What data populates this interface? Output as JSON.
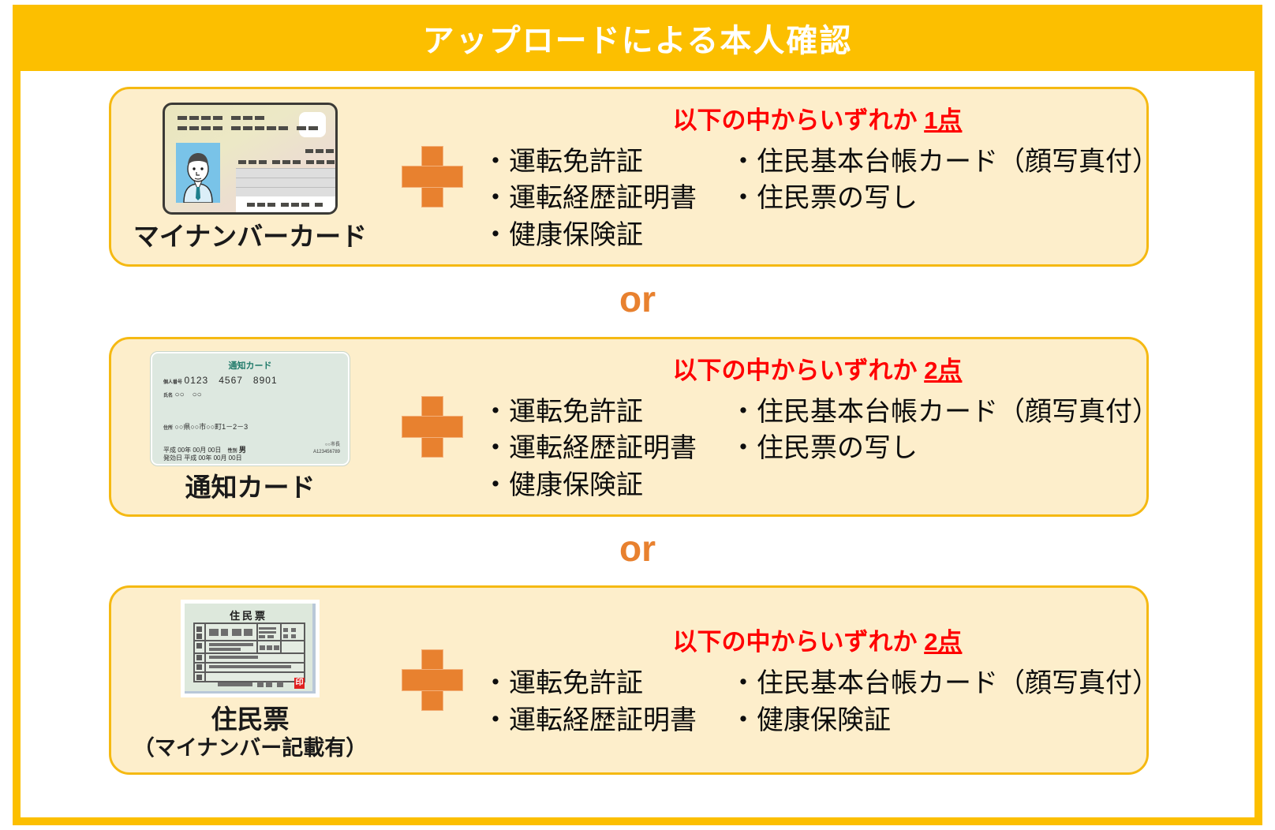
{
  "header": {
    "title": "アップロードによる本人確認",
    "bg_color": "#FCBF00",
    "text_color": "#FFFFFF"
  },
  "colors": {
    "frame_border": "#FCBF00",
    "panel_bg": "#FDEECB",
    "panel_border": "#F5B912",
    "accent_orange": "#E8812F",
    "heading_red": "#FF0000",
    "body_text": "#0D0D0D"
  },
  "separators": {
    "or_label": "or"
  },
  "sections": [
    {
      "id": "mynumber",
      "doc_caption": "マイナンバーカード",
      "doc_caption_sub": "",
      "plus_icon": "plus-icon",
      "heading_prefix": "以下の中からいずれか ",
      "heading_count": "1点",
      "bullets_left": [
        "・運転免許証",
        "・運転経歴証明書",
        "・健康保険証"
      ],
      "bullets_right": [
        "・住民基本台帳カード（顔写真付）",
        "・住民票の写し"
      ],
      "illustration": {
        "type": "mynumber-card",
        "chip": "ic-chip",
        "portrait": "portrait-photo"
      }
    },
    {
      "id": "notification",
      "doc_caption": "通知カード",
      "doc_caption_sub": "",
      "plus_icon": "plus-icon",
      "heading_prefix": "以下の中からいずれか ",
      "heading_count": "2点",
      "bullets_left": [
        "・運転免許証",
        "・運転経歴証明書",
        "・健康保険証"
      ],
      "bullets_right": [
        "・住民基本台帳カード（顔写真付）",
        "・住民票の写し"
      ],
      "illustration": {
        "type": "notification-card",
        "card_title": "通知カード",
        "number_label": "個人番号",
        "number_value": "0123　4567　8901",
        "name_label": "氏名",
        "name_value": "○○　○○",
        "address_label": "住所",
        "address_value": "○○県○○市○○町1－2－3",
        "birth_line": "平成 00年 00月 00日",
        "gender_label": "性別",
        "gender_value": "男",
        "issue_line": "発効日 平成 00年 00月 00日",
        "issuer": "○○市長",
        "serial": "A123456789"
      }
    },
    {
      "id": "juminhyo",
      "doc_caption": "住民票",
      "doc_caption_sub": "（マイナンバー記載有）",
      "plus_icon": "plus-icon",
      "heading_prefix": "以下の中からいずれか ",
      "heading_count": "2点",
      "bullets_left": [
        "・運転免許証",
        "・運転経歴証明書"
      ],
      "bullets_right": [
        "・住民基本台帳カード（顔写真付）",
        "・健康保険証"
      ],
      "illustration": {
        "type": "juminhyo-document",
        "doc_title": "住民票",
        "seal_text": "印"
      }
    }
  ]
}
